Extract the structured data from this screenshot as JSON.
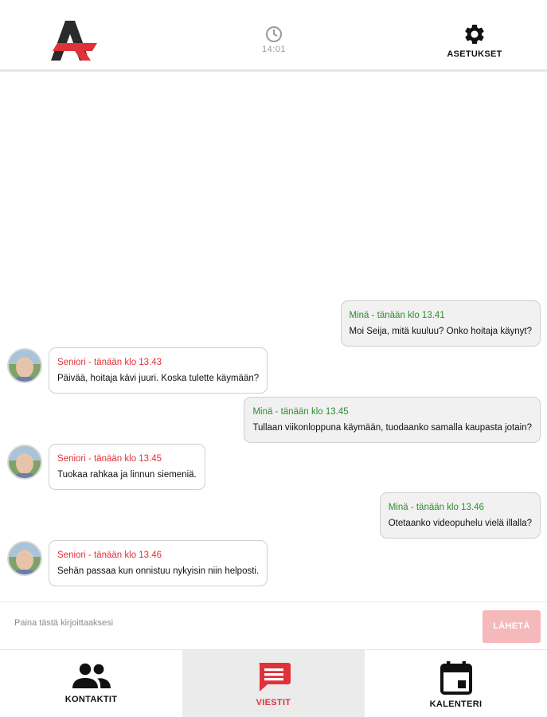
{
  "header": {
    "clock_time": "14:01",
    "settings_label": "ASETUKSET",
    "clock_icon": "clock-icon",
    "settings_icon": "gear-icon",
    "logo_colors": {
      "dark": "#2b2b2b",
      "accent": "#e0323a"
    }
  },
  "messages": [
    {
      "sender": "me",
      "meta": "Minä - tänään klo 13.41",
      "text": "Moi Seija, mitä kuuluu? Onko hoitaja käynyt?"
    },
    {
      "sender": "them",
      "meta": "Seniori - tänään klo 13.43",
      "text": "Päivää, hoitaja kävi juuri. Koska tulette käymään?"
    },
    {
      "sender": "me",
      "meta": "Minä - tänään klo 13.45",
      "text": "Tullaan viikonloppuna käymään, tuodaanko samalla kaupasta jotain?"
    },
    {
      "sender": "them",
      "meta": "Seniori - tänään klo 13.45",
      "text": "Tuokaa rahkaa ja linnun siemeniä."
    },
    {
      "sender": "me",
      "meta": "Minä - tänään klo 13.46",
      "text": "Otetaanko videopuhelu vielä illalla?"
    },
    {
      "sender": "them",
      "meta": "Seniori - tänään klo 13.46",
      "text": "Sehän passaa kun onnistuu nykyisin niin helposti."
    }
  ],
  "composer": {
    "placeholder": "Paina tästä kirjoittaaksesi",
    "send_label": "LÄHETÄ"
  },
  "nav": [
    {
      "label": "KONTAKTIT",
      "icon": "people-icon",
      "active": false
    },
    {
      "label": "VIESTIT",
      "icon": "message-icon",
      "active": true
    },
    {
      "label": "KALENTERI",
      "icon": "calendar-icon",
      "active": false
    }
  ],
  "colors": {
    "accent_red": "#e0323a",
    "me_green": "#2e8b2e",
    "send_disabled": "#f5b8bb"
  }
}
